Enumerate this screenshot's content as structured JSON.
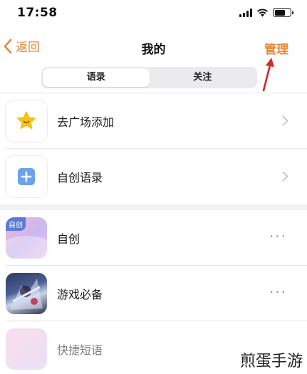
{
  "status_bar": {
    "time": "17:58",
    "battery_level": 0.7
  },
  "nav": {
    "back_label": "返回",
    "title": "我的",
    "manage_label": "管理"
  },
  "segmented": {
    "tabs": [
      {
        "label": "语录",
        "active": true
      },
      {
        "label": "关注",
        "active": false
      }
    ]
  },
  "top_list": [
    {
      "label": "去广场添加",
      "icon": "star-icon"
    },
    {
      "label": "自创语录",
      "icon": "plus-square-icon"
    }
  ],
  "bottom_list": [
    {
      "label": "自创",
      "badge": "自创",
      "icon": "pastel-cover"
    },
    {
      "label": "游戏必备",
      "icon": "game-character-cover"
    },
    {
      "label": "快捷短语",
      "icon": "pastel-cover"
    }
  ],
  "watermark": "煎蛋手游",
  "colors": {
    "accent": "#e8883a",
    "annotation_arrow": "#d42a2a"
  }
}
